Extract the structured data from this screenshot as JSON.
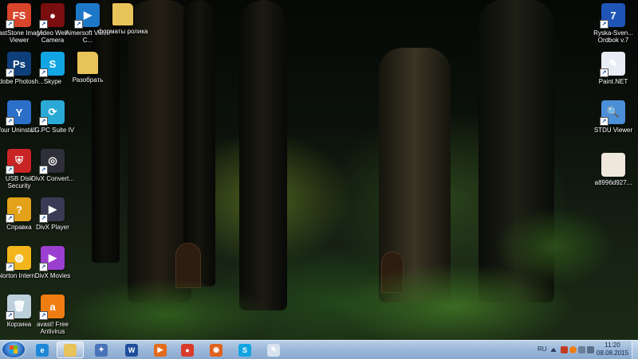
{
  "desktop": {
    "icons_left": [
      {
        "label": "FastStone Image Viewer",
        "icon": "faststone-icon",
        "glyph": "FS",
        "color": "#d9452b"
      },
      {
        "label": "Video Web Camera",
        "icon": "webcam-icon",
        "glyph": "●",
        "color": "#7a0e0e"
      },
      {
        "label": "Aimersoft Video C...",
        "icon": "aimersoft-icon",
        "glyph": "▶",
        "color": "#1e78c8"
      },
      {
        "label": "форматы ролика",
        "icon": "folder-icon",
        "glyph": "",
        "color": "#e8c35a"
      },
      {
        "label": "Adobe Photosh...",
        "icon": "photoshop-icon",
        "glyph": "Ps",
        "color": "#0f3f7a"
      },
      {
        "label": "Skype",
        "icon": "skype-icon",
        "glyph": "S",
        "color": "#12a5e3"
      },
      {
        "label": "Разобрать",
        "icon": "folder-icon",
        "glyph": "",
        "color": "#e8c35a"
      },
      {
        "label": "Your Uninstall...",
        "icon": "uninstaller-icon",
        "glyph": "Y",
        "color": "#2b6fc9"
      },
      {
        "label": "LG PC Suite IV",
        "icon": "lg-pc-suite-icon",
        "glyph": "⟳",
        "color": "#2aa9d6"
      },
      {
        "label": "USB Disk Security",
        "icon": "usb-security-icon",
        "glyph": "⛨",
        "color": "#c92424"
      },
      {
        "label": "DivX Convert...",
        "icon": "divx-converter-icon",
        "glyph": "◎",
        "color": "#2f2f3a"
      },
      {
        "label": "Справка",
        "icon": "help-icon",
        "glyph": "?",
        "color": "#e3a21a"
      },
      {
        "label": "DivX Player",
        "icon": "divx-player-icon",
        "glyph": "▶",
        "color": "#3a3a55"
      },
      {
        "label": "Norton Intern...",
        "icon": "norton-icon",
        "glyph": "◍",
        "color": "#f2b51b"
      },
      {
        "label": "DivX Movies",
        "icon": "divx-movies-icon",
        "glyph": "▶",
        "color": "#9b3fd0"
      },
      {
        "label": "Корзина",
        "icon": "recycle-bin-icon",
        "glyph": "🗑",
        "color": "#bcd0dc"
      },
      {
        "label": "avast! Free Antivirus",
        "icon": "avast-icon",
        "glyph": "a",
        "color": "#f07d12"
      }
    ],
    "icons_right": [
      {
        "label": "Ryska-Sven... Ordbok v.7",
        "icon": "dictionary-flags-icon",
        "glyph": "7",
        "color": "#2055b8"
      },
      {
        "label": "Paint.NET",
        "icon": "paint-net-icon",
        "glyph": "✎",
        "color": "#e8edf5"
      },
      {
        "label": "STDU Viewer",
        "icon": "stdu-viewer-icon",
        "glyph": "🔍",
        "color": "#4b8fd6"
      },
      {
        "label": "a8996d927...",
        "icon": "image-file-icon",
        "glyph": "",
        "color": "#efe6dc"
      }
    ]
  },
  "taskbar": {
    "pinned": [
      {
        "name": "internet-explorer-icon",
        "glyph": "e",
        "color": "#1e88d8",
        "active": false
      },
      {
        "name": "explorer-folder-icon",
        "glyph": "",
        "color": "#e8c35a",
        "active": true
      },
      {
        "name": "tools-icon",
        "glyph": "✦",
        "color": "#4a72b8",
        "active": false
      },
      {
        "name": "word-icon",
        "glyph": "W",
        "color": "#1f4e9c",
        "active": false
      },
      {
        "name": "media-player-icon",
        "glyph": "▶",
        "color": "#e46a1b",
        "active": false
      },
      {
        "name": "chrome-icon",
        "glyph": "●",
        "color": "#d93b2b",
        "active": false
      },
      {
        "name": "firefox-icon",
        "glyph": "◉",
        "color": "#e0621d",
        "active": false
      },
      {
        "name": "skype-icon",
        "glyph": "S",
        "color": "#12a5e3",
        "active": false
      },
      {
        "name": "paint-net-icon",
        "glyph": "✎",
        "color": "#d7e2ef",
        "active": false
      }
    ],
    "language": "RU",
    "time": "11:20",
    "date": "08.08.2015"
  }
}
